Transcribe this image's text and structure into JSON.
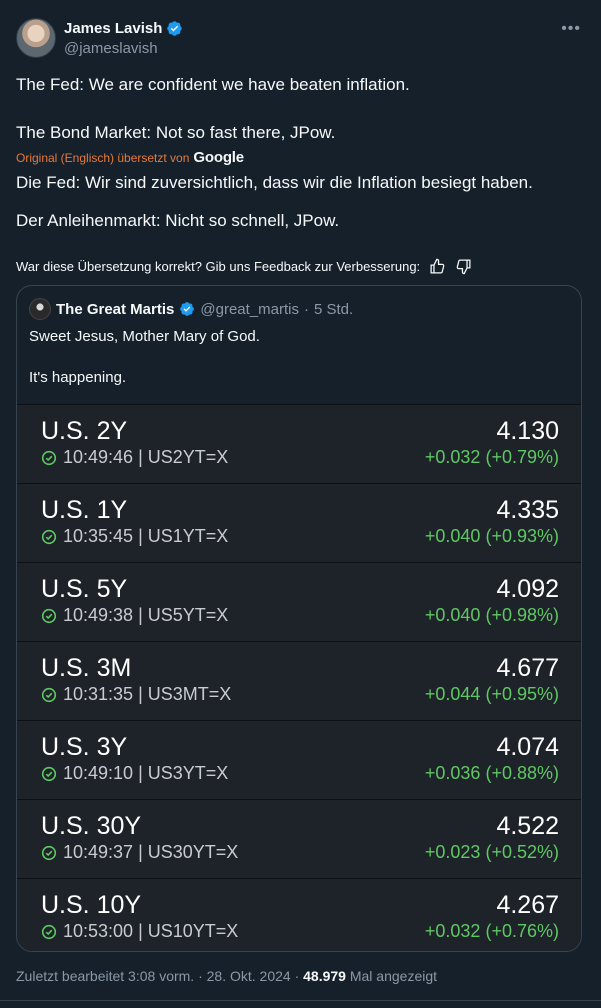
{
  "tweet": {
    "author_name": "James Lavish",
    "author_handle": "@jameslavish",
    "line1": "The Fed: We are confident we have beaten inflation.",
    "line2": "The Bond Market: Not so fast there, JPow.",
    "translation_note": "Original (Englisch) übersetzt von",
    "translation_provider": "Google",
    "translated_line1": "Die Fed: Wir sind zuversichtlich, dass wir die Inflation besiegt haben.",
    "translated_line2": "Der Anleihenmarkt: Nicht so schnell, JPow.",
    "feedback_prompt": "War diese Übersetzung korrekt? Gib uns Feedback zur Verbesserung:",
    "more_icon": "more-horizontal-icon",
    "verified_color": "#1d9bf0"
  },
  "quote": {
    "author_name": "The Great Martis",
    "author_handle": "@great_martis",
    "separator": "·",
    "time": "5 Std.",
    "line1": "Sweet Jesus, Mother Mary of God.",
    "line2": "It's happening.",
    "rows": [
      {
        "title": "U.S. 2Y",
        "meta": "10:49:46 | US2YT=X",
        "price": "4.130",
        "change": "+0.032 (+0.79%)"
      },
      {
        "title": "U.S. 1Y",
        "meta": "10:35:45 | US1YT=X",
        "price": "4.335",
        "change": "+0.040 (+0.93%)"
      },
      {
        "title": "U.S. 5Y",
        "meta": "10:49:38 | US5YT=X",
        "price": "4.092",
        "change": "+0.040 (+0.98%)"
      },
      {
        "title": "U.S. 3M",
        "meta": "10:31:35 | US3MT=X",
        "price": "4.677",
        "change": "+0.044 (+0.95%)"
      },
      {
        "title": "U.S. 3Y",
        "meta": "10:49:10 | US3YT=X",
        "price": "4.074",
        "change": "+0.036 (+0.88%)"
      },
      {
        "title": "U.S. 30Y",
        "meta": "10:49:37 | US30YT=X",
        "price": "4.522",
        "change": "+0.023 (+0.52%)"
      },
      {
        "title": "U.S. 10Y",
        "meta": "10:53:00 | US10YT=X",
        "price": "4.267",
        "change": "+0.032 (+0.76%)"
      }
    ],
    "positive_color": "#5fc764"
  },
  "footer": {
    "edited": "Zuletzt bearbeitet 3:08 vorm. · 28. Okt. 2024 ·",
    "views_count": "48.979",
    "views_label": "Mal angezeigt"
  }
}
